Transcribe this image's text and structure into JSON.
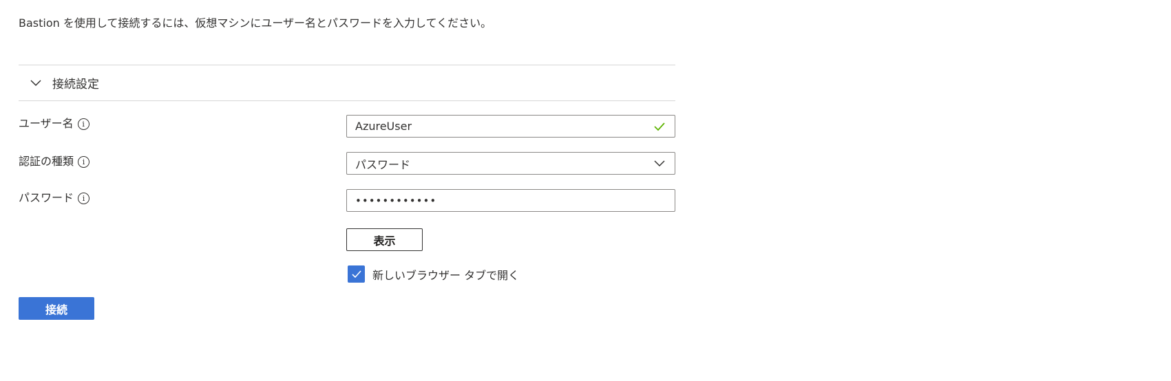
{
  "intro_text": "Bastion を使用して接続するには、仮想マシンにユーザー名とパスワードを入力してください。",
  "section": {
    "title": "接続設定",
    "icon": "chevron-down-icon"
  },
  "fields": {
    "username": {
      "label": "ユーザー名",
      "value": "AzureUser",
      "valid": true,
      "valid_color": "#5db300"
    },
    "auth_type": {
      "label": "認証の種類",
      "value": "パスワード"
    },
    "password": {
      "label": "パスワード",
      "value": "••••••••••••"
    }
  },
  "info_glyph": "i",
  "show_button": {
    "label": "表示"
  },
  "open_in_new_tab": {
    "label": "新しいブラウザー タブで開く",
    "checked": true
  },
  "connect_button": {
    "label": "接続"
  },
  "colors": {
    "accent": "#3a74d6",
    "text": "#323130",
    "border": "#8a8886",
    "divider": "#d6d6d6",
    "valid": "#5db300"
  }
}
